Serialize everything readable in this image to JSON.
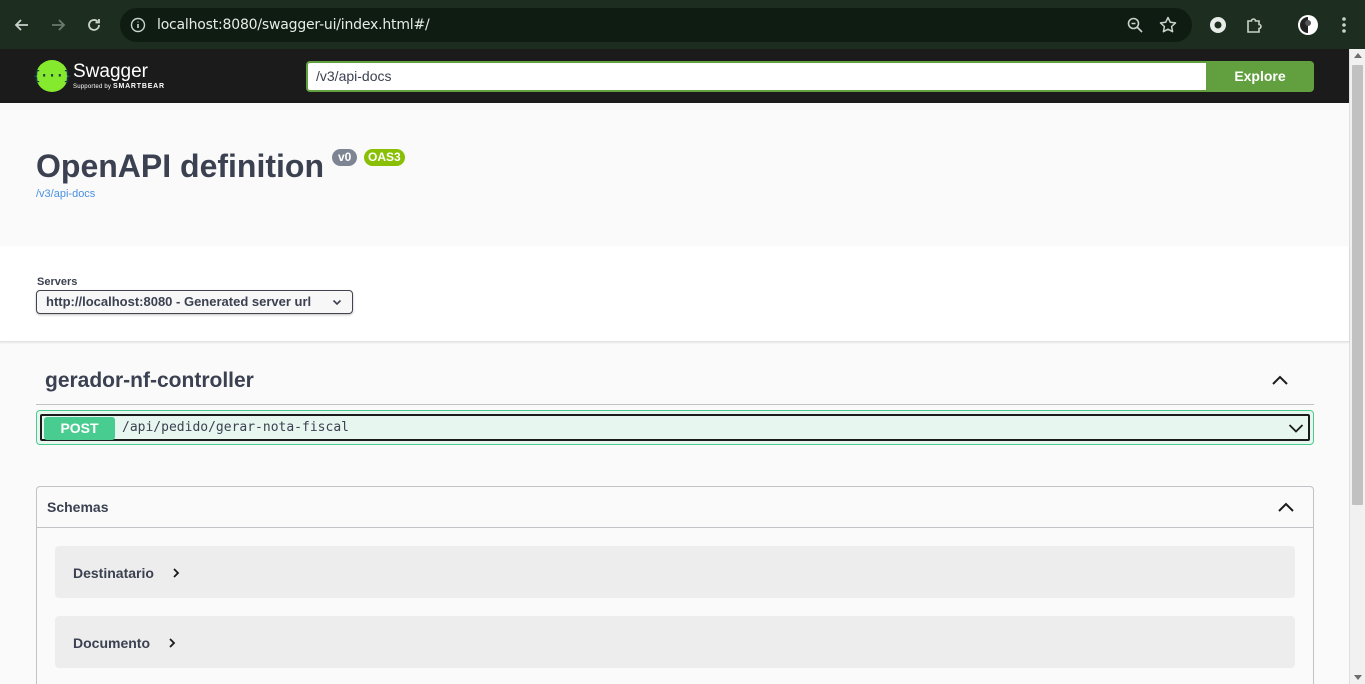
{
  "browser": {
    "url": "localhost:8080/swagger-ui/index.html#/"
  },
  "topbar": {
    "brand": "Swagger",
    "brand_sub_prefix": "Supported by",
    "brand_sub_company": "SMARTBEAR",
    "logo_glyph": "{···}",
    "spec_url": "/v3/api-docs",
    "explore_label": "Explore"
  },
  "info": {
    "title": "OpenAPI definition",
    "version_badge": "v0",
    "oas_badge": "OAS3",
    "spec_link": "/v3/api-docs"
  },
  "servers": {
    "label": "Servers",
    "selected": "http://localhost:8080 - Generated server url"
  },
  "tag": {
    "name": "gerador-nf-controller",
    "operations": [
      {
        "method": "POST",
        "path": "/api/pedido/gerar-nota-fiscal"
      }
    ]
  },
  "schemas": {
    "title": "Schemas",
    "items": [
      "Destinatario",
      "Documento"
    ]
  },
  "colors": {
    "post": "#49cc90",
    "explore": "#62a03f",
    "oas": "#89bf04",
    "topbar": "#1b1b1b"
  }
}
